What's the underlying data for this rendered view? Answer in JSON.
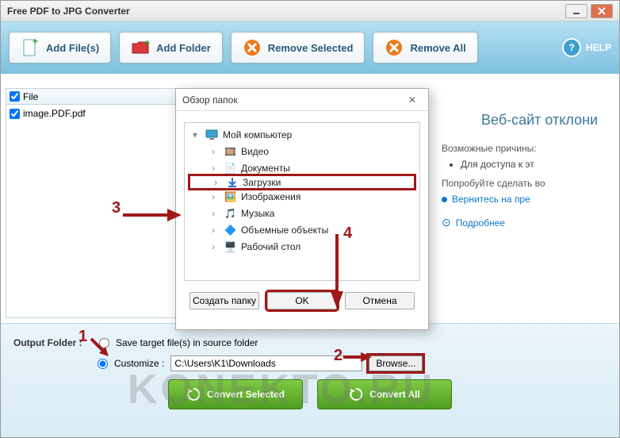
{
  "window": {
    "title": "Free PDF to JPG Converter"
  },
  "toolbar": {
    "add_files": "Add File(s)",
    "add_folder": "Add Folder",
    "remove_selected": "Remove Selected",
    "remove_all": "Remove All",
    "help": "HELP"
  },
  "filelist": {
    "header": "File",
    "items": [
      "image.PDF.pdf"
    ]
  },
  "sidepanel": {
    "heading": "Веб-сайт отклони",
    "sub1": "Возможные причины:",
    "li1": "Для доступа к эт",
    "sub2": "Попробуйте сделать во",
    "link_back": "Вернитесь на пре",
    "link_more": "Подробнее"
  },
  "dialog": {
    "title": "Обзор папок",
    "root": "Мой компьютер",
    "nodes": [
      "Видео",
      "Документы",
      "Загрузки",
      "Изображения",
      "Музыка",
      "Объемные объекты",
      "Рабочий стол"
    ],
    "create": "Создать папку",
    "ok": "OK",
    "cancel": "Отмена"
  },
  "output": {
    "label": "Output Folder :",
    "opt_source": "Save target file(s) in source folder",
    "opt_custom": "Customize :",
    "path": "C:\\Users\\K1\\Downloads",
    "browse": "Browse..."
  },
  "convert": {
    "selected": "Convert Selected",
    "all": "Convert All"
  },
  "annotations": {
    "n1": "1",
    "n2": "2",
    "n3": "3",
    "n4": "4"
  },
  "watermark": "KONEKTO.RU"
}
